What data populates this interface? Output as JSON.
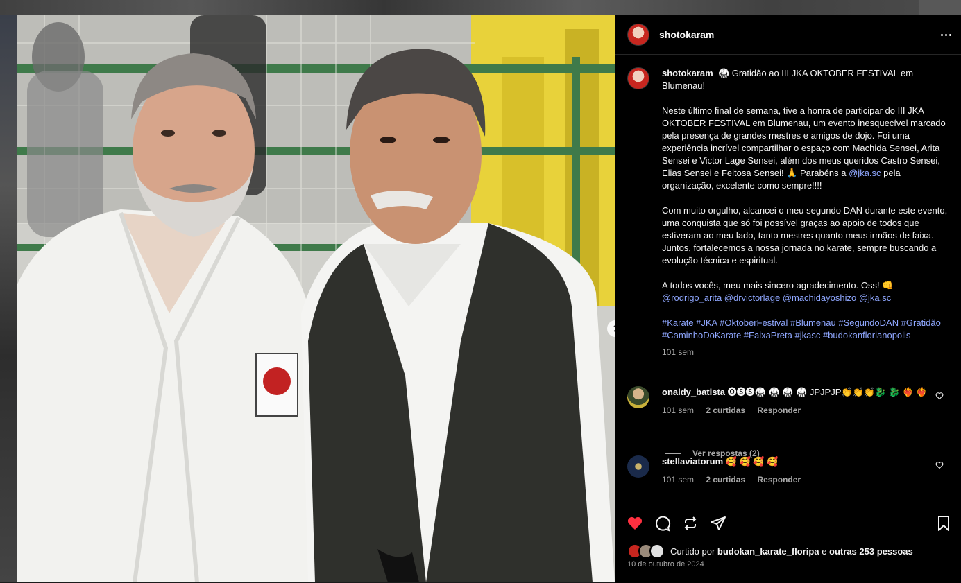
{
  "post": {
    "username": "shotokaram",
    "caption_title": "🥋 Gratidão ao III JKA OKTOBER FESTIVAL em Blumenau!",
    "paragraph1_a": "Neste último final de semana, tive a honra de participar do III JKA OKTOBER FESTIVAL em Blumenau, um evento inesquecível marcado pela presença de grandes mestres e amigos de dojo. Foi uma experiência incrível compartilhar o espaço com Machida Sensei, Arita Sensei e Victor Lage Sensei, além dos meus queridos Castro Sensei, Elias Sensei e Feitosa Sensei! 🙏 Parabéns a ",
    "paragraph1_link": "@jka.sc",
    "paragraph1_b": " pela organização, excelente como sempre!!!!",
    "paragraph2": "Com muito orgulho, alcancei o meu segundo DAN durante este evento, uma conquista que só foi possível graças ao apoio de todos que estiveram ao meu lado, tanto mestres quanto meus irmãos de faixa. Juntos, fortalecemos a nossa jornada no karate, sempre buscando a evolução técnica e espiritual.",
    "paragraph3": "A todos vocês, meu mais sincero agradecimento. Oss! 👊",
    "mentions": "@rodrigo_arita @drvictorlage @machidayoshizo @jka.sc",
    "hashtags": "#Karate #JKA #OktoberFestival #Blumenau #SegundoDAN #Gratidão #CaminhoDoKarate #FaixaPreta #jkasc #budokanflorianopolis",
    "time": "101 sem"
  },
  "comments": [
    {
      "username": "onaldy_batista",
      "text": "🅞🅢🅢🥋 🥋 🥋 🥋 JPJPJP👏👏👏🐉 🐉 ❤️‍🔥 ❤️‍🔥",
      "time": "101 sem",
      "likes": "2 curtidas",
      "reply": "Responder"
    },
    {
      "username": "stellaviatorum",
      "text": "🥰 🥰 🥰 🥰",
      "time": "101 sem",
      "likes": "2 curtidas",
      "reply": "Responder"
    }
  ],
  "view_replies": "Ver respostas (2)",
  "likes_prefix": "Curtido por ",
  "likes_user": "budokan_karate_floripa",
  "likes_middle": " e ",
  "likes_others": "outras 253 pessoas",
  "date": "10 de outubro de 2024",
  "colors": {
    "accent_like": "#ff3040",
    "link": "#8fa7ff",
    "panel_bg": "#000000"
  }
}
